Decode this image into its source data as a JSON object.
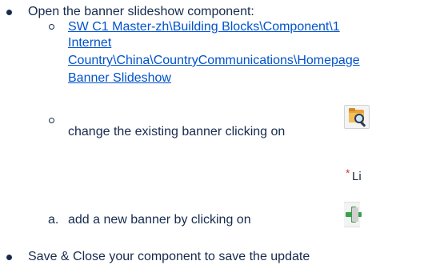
{
  "list": {
    "item1_text": "Open the banner slideshow component:",
    "item1_link_line1": "SW C1 Master-zh\\Building Blocks\\Component\\1",
    "item1_link_line2": "Internet",
    "item1_link_line3": "Country\\China\\CountryCommunications\\Homepage",
    "item1_link_line4": "Banner Slideshow",
    "item2_text": "change the existing banner clicking on",
    "item3_marker": "a.",
    "item3_text": "add a new banner by clicking on",
    "item4_text": "Save & Close your component to save the update"
  },
  "list_widget": {
    "required_marker": "*",
    "label": "List:"
  },
  "icons": {
    "open_icon": "search-folder-icon",
    "add_icon": "plus-icon",
    "delete_icon": "trash-icon"
  },
  "colors": {
    "text": "#172b4d",
    "link": "#0052cc",
    "plus": "#3aa14a",
    "folder": "#e8a33c",
    "required": "#d63a3a"
  }
}
